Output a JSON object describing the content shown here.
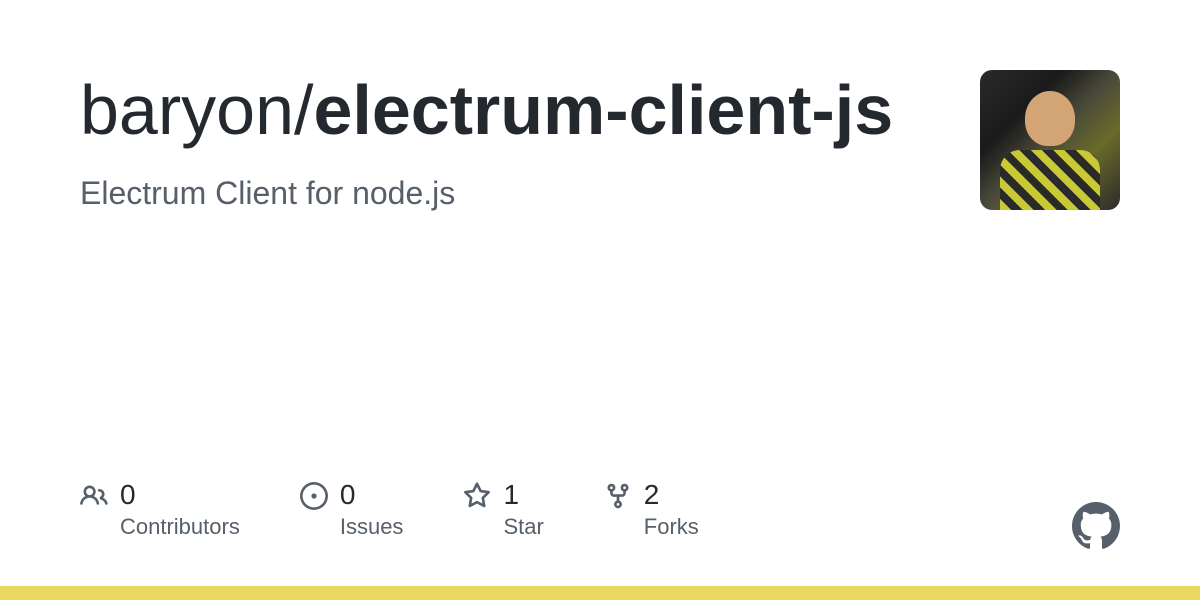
{
  "repo": {
    "owner": "baryon",
    "separator": "/",
    "name": "electrum-client-js",
    "description": "Electrum Client for node.js"
  },
  "stats": {
    "contributors": {
      "count": "0",
      "label": "Contributors"
    },
    "issues": {
      "count": "0",
      "label": "Issues"
    },
    "stars": {
      "count": "1",
      "label": "Star"
    },
    "forks": {
      "count": "2",
      "label": "Forks"
    }
  }
}
